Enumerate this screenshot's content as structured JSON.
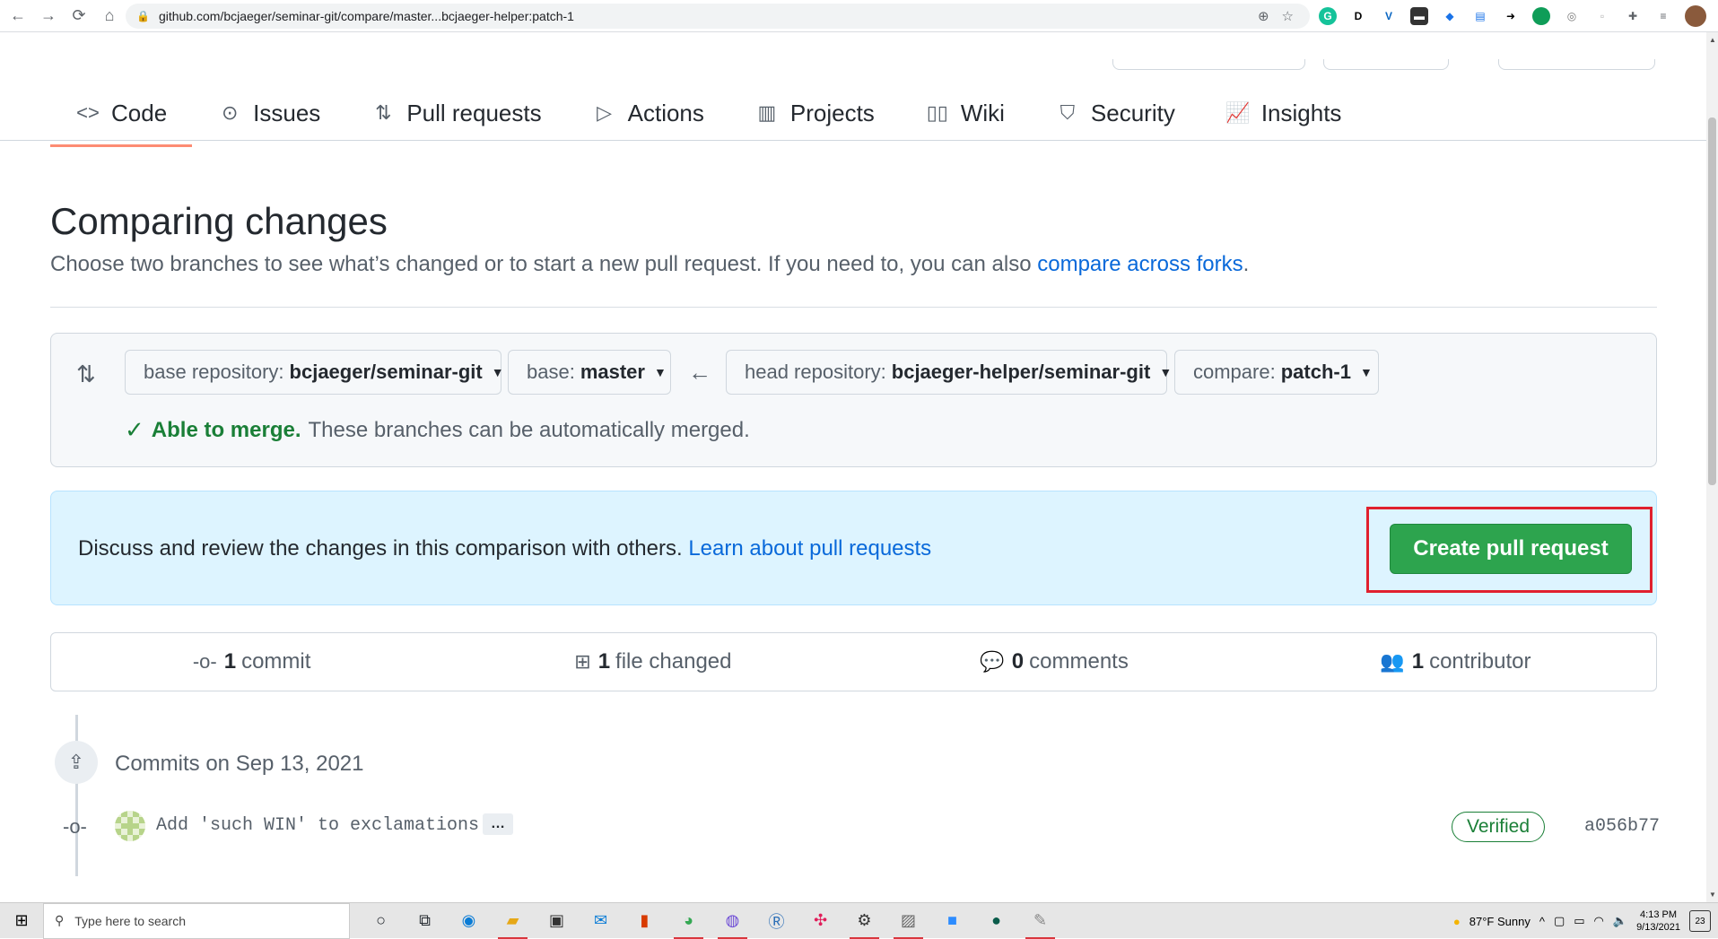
{
  "browser": {
    "url": "github.com/bcjaeger/seminar-git/compare/master...bcjaeger-helper:patch-1"
  },
  "repo_nav": {
    "tabs": [
      {
        "label": "Code",
        "icon": "code-icon"
      },
      {
        "label": "Issues",
        "icon": "issue-icon"
      },
      {
        "label": "Pull requests",
        "icon": "pull-request-icon"
      },
      {
        "label": "Actions",
        "icon": "play-icon"
      },
      {
        "label": "Projects",
        "icon": "project-icon"
      },
      {
        "label": "Wiki",
        "icon": "book-icon"
      },
      {
        "label": "Security",
        "icon": "shield-icon"
      },
      {
        "label": "Insights",
        "icon": "graph-icon"
      }
    ],
    "active_tab": "Code"
  },
  "compare": {
    "title": "Comparing changes",
    "subtitle_text": "Choose two branches to see what’s changed or to start a new pull request. If you need to, you can also",
    "subtitle_link": "compare across forks",
    "subtitle_end": ".",
    "base_repo_label": "base repository:",
    "base_repo_value": "bcjaeger/seminar-git",
    "base_label": "base:",
    "base_value": "master",
    "head_repo_label": "head repository:",
    "head_repo_value": "bcjaeger-helper/seminar-git",
    "compare_label": "compare:",
    "compare_value": "patch-1",
    "merge_ok": "Able to merge.",
    "merge_text": "These branches can be automatically merged."
  },
  "discuss": {
    "text": "Discuss and review the changes in this comparison with others.",
    "link": "Learn about pull requests",
    "button": "Create pull request"
  },
  "summary": {
    "commits_count": "1",
    "commits_label": "commit",
    "files_count": "1",
    "files_label": "file changed",
    "comments_count": "0",
    "comments_label": "comments",
    "contributors_count": "1",
    "contributors_label": "contributor"
  },
  "commits": {
    "date_heading": "Commits on Sep 13, 2021",
    "items": [
      {
        "message": "Add 'such WIN' to exclamations",
        "verified": "Verified",
        "sha": "a056b77"
      }
    ]
  },
  "taskbar": {
    "search_placeholder": "Type here to search",
    "weather": "87°F  Sunny",
    "time": "4:13 PM",
    "date": "9/13/2021",
    "notifications": "23"
  },
  "colors": {
    "accent_link": "#0969da",
    "success": "#1a7f37",
    "button_green": "#2da44e",
    "highlight_red": "#e0202e",
    "active_tab_underline": "#fd8c73"
  }
}
